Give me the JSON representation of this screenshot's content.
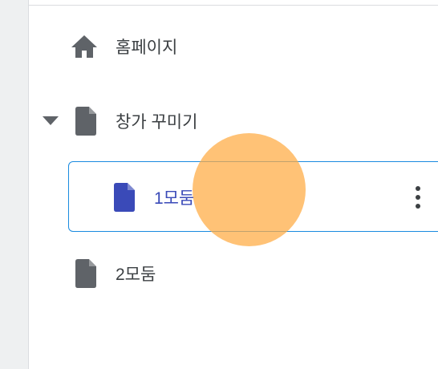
{
  "nav": {
    "home": {
      "label": "홈페이지",
      "icon": "home-icon"
    },
    "site": {
      "label": "창가 꾸미기",
      "icon": "page-icon",
      "expanded": true
    },
    "pages": [
      {
        "label": "1모둠",
        "icon": "page-icon",
        "selected": true
      },
      {
        "label": "2모둠",
        "icon": "page-icon",
        "selected": false
      }
    ]
  },
  "colors": {
    "selected_border": "#1a8be0",
    "selected_text": "#3a4ab8",
    "selected_icon": "#3a4ab8",
    "icon_default": "#5f6368",
    "touch_indicator": "#ffb955"
  }
}
